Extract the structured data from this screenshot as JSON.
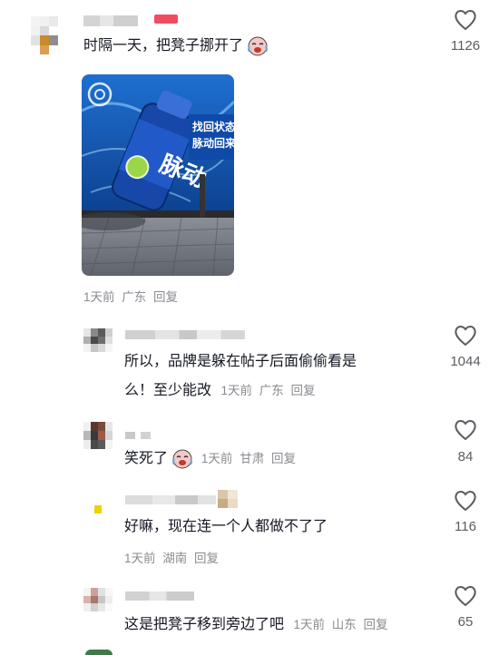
{
  "comments": [
    {
      "text": "时隔一天，把凳子挪开了",
      "meta": {
        "time": "1天前",
        "location": "广东",
        "reply": "回复"
      },
      "likes": "1126"
    },
    {
      "text_line1": "所以，品牌是躲在帖子后面偷偷看是",
      "text_line2": "么！至少能改",
      "meta": {
        "time": "1天前",
        "location": "广东",
        "reply": "回复"
      },
      "likes": "1044"
    },
    {
      "text": "笑死了",
      "meta": {
        "time": "1天前",
        "location": "甘肃",
        "reply": "回复"
      },
      "likes": "84"
    },
    {
      "text": "好嘛，现在连一个人都做不了了",
      "meta": {
        "time": "1天前",
        "location": "湖南",
        "reply": "回复"
      },
      "likes": "116"
    },
    {
      "text": "这是把凳子移到旁边了吧",
      "meta": {
        "time": "1天前",
        "location": "山东",
        "reply": "回复"
      },
      "likes": "65"
    }
  ],
  "photo": {
    "brand_text": "脉动",
    "slogan_line1": "找回状态",
    "slogan_line2": "脉动回来"
  },
  "icons": {
    "like": "heart-outline-icon",
    "emoji": "crying-laughing-emoji-icon"
  },
  "colors": {
    "text": "#161823",
    "meta": "#8a8b91",
    "accent": "#fe2c55"
  }
}
